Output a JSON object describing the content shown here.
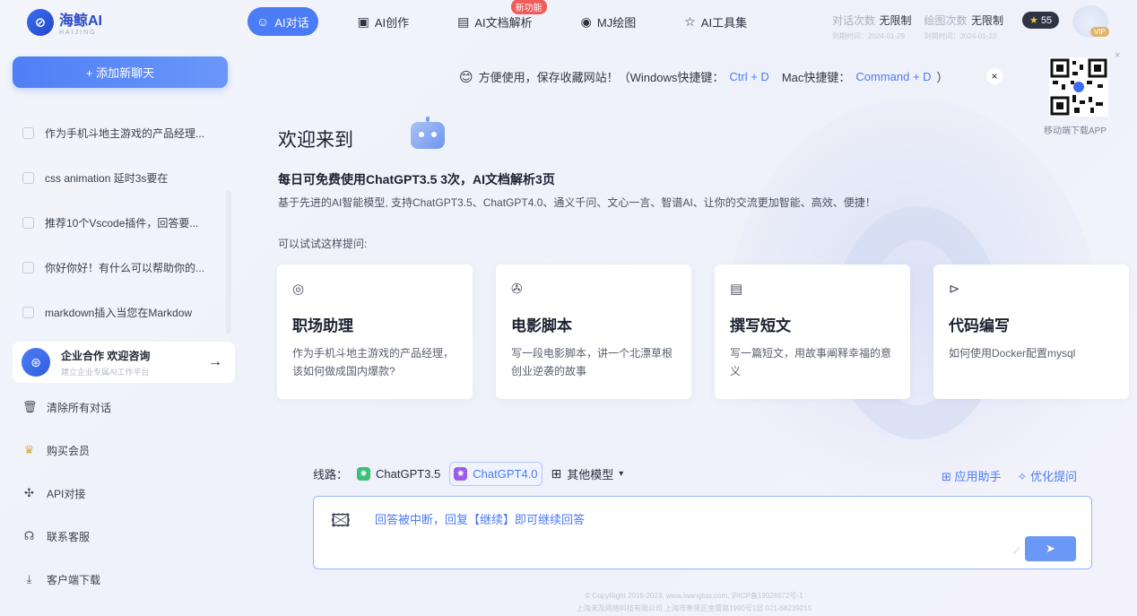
{
  "brand": {
    "name": "海鲸AI",
    "sub": "HAIJING"
  },
  "nav": [
    {
      "label": "AI对话",
      "icon": "☺",
      "active": true
    },
    {
      "label": "AI创作",
      "icon": "▣"
    },
    {
      "label": "AI文档解析",
      "icon": "▤",
      "badge": "新功能"
    },
    {
      "label": "MJ绘图",
      "icon": "◉"
    },
    {
      "label": "AI工具集",
      "icon": "☆"
    }
  ],
  "stats": [
    {
      "label": "对话次数",
      "value": "无限制",
      "sub": "到期时间：2024-01-29"
    },
    {
      "label": "绘图次数",
      "value": "无限制",
      "sub": "到期时间：2024-01-22"
    }
  ],
  "points": "55",
  "vip": "VIP",
  "sidebar": {
    "new_chat": "+ 添加新聊天",
    "history": [
      "作为手机斗地主游戏的产品经理...",
      "css animation 延时3s要在",
      "推荐10个Vscode插件，回答要...",
      "你好你好！有什么可以帮助你的...",
      "markdown插入当您在Markdow"
    ],
    "enterprise": {
      "title": "企业合作 欢迎咨询",
      "sub": "建立企业专属AI工作平台"
    },
    "menu": [
      {
        "label": "清除所有对话",
        "icon": "🗑"
      },
      {
        "label": "购买会员",
        "icon": "♛"
      },
      {
        "label": "API对接",
        "icon": "✣"
      },
      {
        "label": "联系客服",
        "icon": "☊"
      },
      {
        "label": "客户端下载",
        "icon": "⤓"
      }
    ]
  },
  "notice": {
    "text": "方便使用，保存收藏网站！（Windows快捷键：",
    "win_key": "Ctrl + D",
    "mid": "Mac快捷键：",
    "mac_key": "Command + D",
    "end": "）"
  },
  "qr_label": "移动端下载APP",
  "welcome": {
    "title": "欢迎来到",
    "free": "每日可免费使用ChatGPT3.5 3次，AI文档解析3页",
    "desc": "基于先进的AI智能模型, 支持ChatGPT3.5、ChatGPT4.0、通义千问、文心一言、智谱AI、让你的交流更加智能、高效、便捷！",
    "try": "可以试试这样提问:"
  },
  "cards": [
    {
      "icon": "◎",
      "title": "职场助理",
      "desc": "作为手机斗地主游戏的产品经理，该如何做成国内爆款?"
    },
    {
      "icon": "✇",
      "title": "电影脚本",
      "desc": "写一段电影脚本，讲一个北漂草根创业逆袭的故事"
    },
    {
      "icon": "▤",
      "title": "撰写短文",
      "desc": "写一篇短文，用故事阐释幸福的意义"
    },
    {
      "icon": "⊳",
      "title": "代码编写",
      "desc": "如何使用Docker配置mysql"
    }
  ],
  "route": {
    "label": "线路：",
    "models": [
      {
        "label": "ChatGPT3.5",
        "color": "#3bbf7a"
      },
      {
        "label": "ChatGPT4.0",
        "color": "#9b5de5",
        "selected": true
      }
    ],
    "other": "其他模型",
    "helpers": [
      "应用助手",
      "优化提问"
    ]
  },
  "input": {
    "value": "回答被中断，回复【继续】即可继续回答"
  },
  "footer": [
    "© CopyRight 2016-2023, www.iwangtuo.com, 沪ICP备19026672号-1",
    "上海未及网络科技有限公司  上海市奉贤区金蕾路1990号1层  021-68239215"
  ]
}
